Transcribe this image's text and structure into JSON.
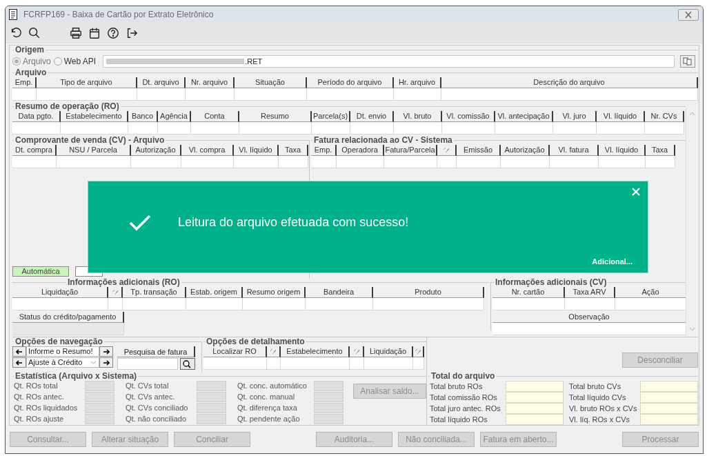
{
  "window": {
    "title": "FCRFP169 - Baixa de Cartão por Extrato Eletrônico"
  },
  "origem": {
    "legend": "Origem",
    "options": [
      {
        "label": "Arquivo",
        "selected": true
      },
      {
        "label": "Web API",
        "selected": false
      }
    ],
    "file_value": ".RET"
  },
  "arquivo": {
    "legend": "Arquivo",
    "columns": [
      {
        "kind": "text",
        "label": "Emp."
      },
      {
        "kind": "text",
        "label": "Tipo de arquivo"
      },
      {
        "kind": "text",
        "label": "Dt. arquivo"
      },
      {
        "kind": "text",
        "label": "Nr. arquivo"
      },
      {
        "kind": "text",
        "label": "Situação"
      },
      {
        "kind": "text",
        "label": "Período do arquivo"
      },
      {
        "kind": "text",
        "label": "Hr. arquivo"
      },
      {
        "kind": "text",
        "label": "Descrição do arquivo"
      }
    ]
  },
  "resumo_ro": {
    "legend": "Resumo de operação (RO)",
    "columns": [
      {
        "kind": "text",
        "label": "Data pgto."
      },
      {
        "kind": "text",
        "label": "Estabelecimento"
      },
      {
        "kind": "text",
        "label": "Banco"
      },
      {
        "kind": "text",
        "label": "Agência"
      },
      {
        "kind": "text",
        "label": "Conta"
      },
      {
        "kind": "text",
        "label": "Resumo"
      },
      {
        "kind": "text",
        "label": "Parcela(s)"
      },
      {
        "kind": "text",
        "label": "Dt. envio"
      },
      {
        "kind": "text",
        "label": "Vl. bruto"
      },
      {
        "kind": "text",
        "label": "Vl. comissão"
      },
      {
        "kind": "text",
        "label": "Vl. antecipação"
      },
      {
        "kind": "text",
        "label": "Vl. juro"
      },
      {
        "kind": "text",
        "label": "Vl. líquido"
      },
      {
        "kind": "text",
        "label": "Nr. CVs"
      }
    ]
  },
  "cv_arquivo": {
    "legend": "Comprovante de venda (CV) - Arquivo",
    "columns": [
      {
        "kind": "text",
        "label": "Dt. compra"
      },
      {
        "kind": "text",
        "label": "NSU / Parcela"
      },
      {
        "kind": "text",
        "label": "Autorização"
      },
      {
        "kind": "text",
        "label": "Vl. compra"
      },
      {
        "kind": "text",
        "label": "Vl. líquido"
      },
      {
        "kind": "text",
        "label": "Taxa"
      }
    ],
    "mode_tag": "Automática"
  },
  "fatura_cv": {
    "legend": "Fatura relacionada ao CV - Sistema",
    "columns": [
      {
        "kind": "text",
        "label": "Emp."
      },
      {
        "kind": "text",
        "label": "Operadora"
      },
      {
        "kind": "text",
        "label": "Fatura/Parcela"
      },
      {
        "kind": "icon"
      },
      {
        "kind": "text",
        "label": "Emissão"
      },
      {
        "kind": "text",
        "label": "Autorização"
      },
      {
        "kind": "text",
        "label": "Vl. fatura"
      },
      {
        "kind": "text",
        "label": "Vl. líquido"
      },
      {
        "kind": "text",
        "label": "Taxa"
      }
    ]
  },
  "info_ro": {
    "legend": "Informações adicionais (RO)",
    "columns": [
      {
        "kind": "text",
        "label": "Liquidação"
      },
      {
        "kind": "icon"
      },
      {
        "kind": "text",
        "label": "Tp. transação"
      },
      {
        "kind": "text",
        "label": "Estab. origem"
      },
      {
        "kind": "text",
        "label": "Resumo origem"
      },
      {
        "kind": "text",
        "label": "Bandeira"
      },
      {
        "kind": "text",
        "label": "Produto"
      }
    ],
    "status_column": "Status do crédito/pagamento"
  },
  "info_cv": {
    "legend": "Informações adicionais (CV)",
    "columns": [
      {
        "kind": "text",
        "label": "Nr. cartão"
      },
      {
        "kind": "text",
        "label": "Taxa ARV"
      },
      {
        "kind": "text",
        "label": "Ação"
      }
    ],
    "observacao_column": "Observação"
  },
  "navegacao": {
    "legend": "Opções de navegação",
    "rows": [
      {
        "kind": "text",
        "value": "Informe o Resumo!"
      },
      {
        "kind": "dropdown",
        "value": "Ajuste à Crédito"
      }
    ],
    "search_column": "Pesquisa de fatura"
  },
  "detalhamento": {
    "legend": "Opções de detalhamento",
    "columns": [
      {
        "kind": "text",
        "label": "Localizar RO"
      },
      {
        "kind": "icon"
      },
      {
        "kind": "text",
        "label": "Estabelecimento"
      },
      {
        "kind": "icon"
      },
      {
        "kind": "text",
        "label": "Liquidação"
      },
      {
        "kind": "icon"
      }
    ]
  },
  "desconciliar_button": {
    "label": "Desconciliar",
    "disabled": true
  },
  "estatistica": {
    "legend": "Estatística (Arquivo x Sistema)",
    "groups": [
      [
        "Qt. ROs total",
        "Qt. ROs antec.",
        "Qt. ROs liquidados",
        "Qt. ROs ajuste"
      ],
      [
        "Qt. CVs total",
        "Qt. CVs antec.",
        "Qt. CVs conciliado",
        "Qt. não conciliado"
      ],
      [
        "Qt. conc. automático",
        "Qt. conc. manual",
        "Qt. diferença taxa",
        "Qt. pendente ação"
      ]
    ],
    "analisar_button": {
      "label": "Analisar saldo...",
      "disabled": true
    }
  },
  "total_arquivo": {
    "legend": "Total do arquivo",
    "groups": [
      [
        "Total bruto ROs",
        "Total comissão ROs",
        "Total juro antec. ROs",
        "Total líquido ROs"
      ],
      [
        "Total bruto CVs",
        "Total líquido CVs",
        "Vl. bruto ROs x CVs",
        "Vl. líq. ROs x CVs"
      ]
    ]
  },
  "toast": {
    "message": "Leitura do arquivo efetuada com sucesso!",
    "link": "Adicional..."
  },
  "button_groups": [
    [
      {
        "label": "Consultar...",
        "disabled": true
      },
      {
        "label": "Alterar situação",
        "disabled": true
      },
      {
        "label": "Conciliar",
        "disabled": true
      }
    ],
    [
      {
        "label": "Auditoria...",
        "disabled": true
      },
      {
        "label": "Não conciliada...",
        "disabled": true
      },
      {
        "label": "Fatura em aberto...",
        "disabled": true
      }
    ],
    [
      {
        "label": "Processar",
        "disabled": true
      }
    ]
  ]
}
